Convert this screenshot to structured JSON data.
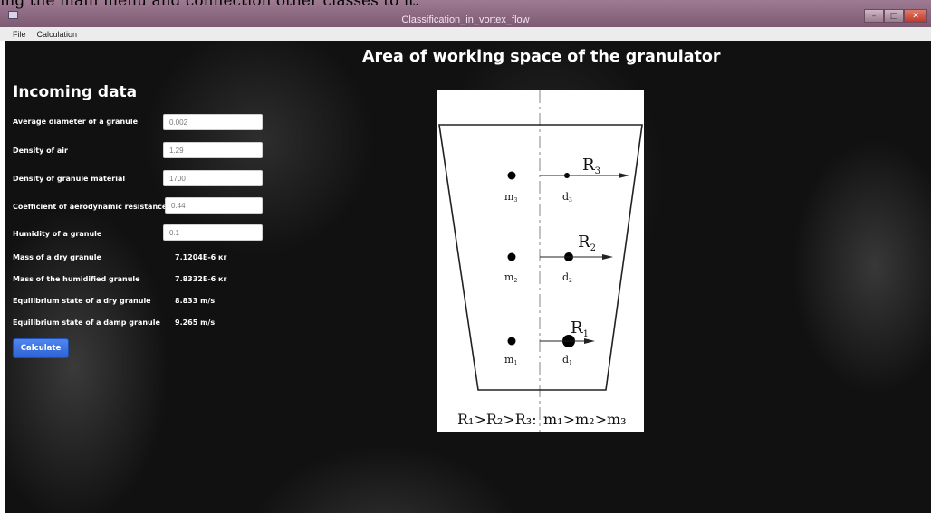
{
  "caption": "ing the main menu and connection other classes to it.",
  "window": {
    "title": "Classification_in_vortex_flow",
    "icon": "app-icon",
    "controls": [
      "minimize-icon",
      "maximize-icon",
      "close-icon"
    ]
  },
  "menu": {
    "file": "File",
    "calculation": "Calculation"
  },
  "main": {
    "area_title": "Area of working space of the granulator",
    "incoming_title": "Incoming data",
    "fields": [
      {
        "label": "Average diameter of a granule",
        "value": "0.002"
      },
      {
        "label": "Density of air",
        "value": "1.29"
      },
      {
        "label": "Density of granule material",
        "value": "1700"
      },
      {
        "label": "Coefficient of aerodynamic resistance",
        "value": "0.44"
      },
      {
        "label": "Humidity of a granule",
        "value": "0.1"
      }
    ],
    "results": [
      {
        "label": "Mass of a dry granule",
        "value": "7.1204E-6 кг"
      },
      {
        "label": "Mass of the humidified granule",
        "value": "7.8332E-6 кг"
      },
      {
        "label": "Equilibrium state of a dry granule",
        "value": "8.833 m/s"
      },
      {
        "label": "Equilibrium state of a damp granule",
        "value": "9.265 m/s"
      }
    ],
    "calculate_label": "Calculate"
  },
  "diagram": {
    "levels": [
      {
        "r": "R",
        "r_sub": "3",
        "m": "m",
        "m_sub": "3",
        "d": "d",
        "d_sub": "3"
      },
      {
        "r": "R",
        "r_sub": "2",
        "m": "m",
        "m_sub": "2",
        "d": "d",
        "d_sub": "2"
      },
      {
        "r": "R",
        "r_sub": "1",
        "m": "m",
        "m_sub": "1",
        "d": "d",
        "d_sub": "1"
      }
    ],
    "relation_left": "R₁>R₂>R₃:",
    "relation_right": "m₁>m₂>m₃"
  },
  "colors": {
    "titlebar": "#8a6880",
    "button": "#3a70e0",
    "background": "#111111",
    "close": "#c0392b"
  }
}
